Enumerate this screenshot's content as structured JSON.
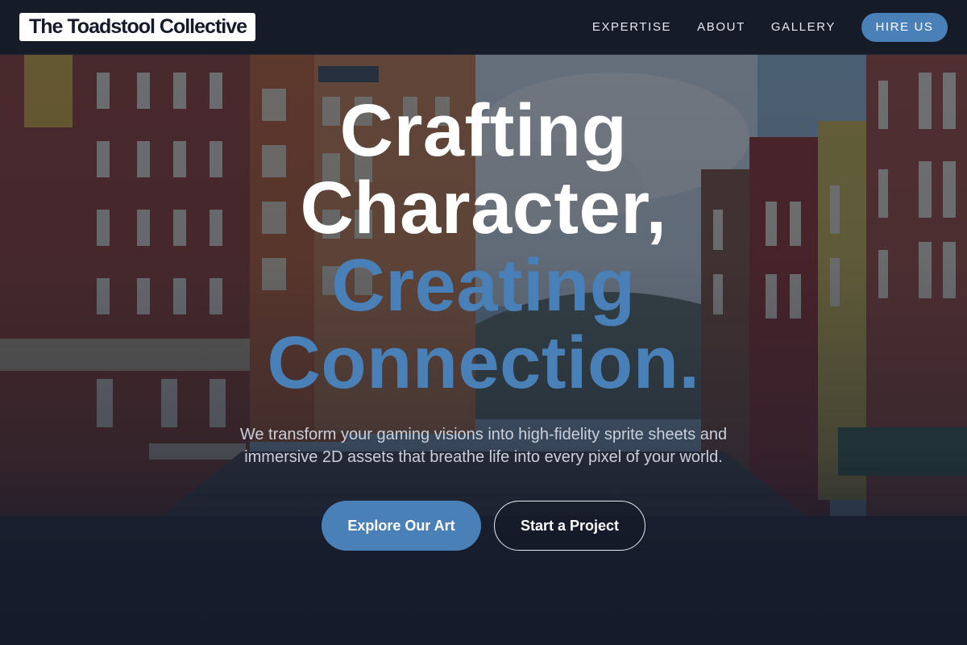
{
  "nav": {
    "brand": "The Toadstool Collective",
    "links": [
      {
        "label": "EXPERTISE"
      },
      {
        "label": "ABOUT"
      },
      {
        "label": "GALLERY"
      }
    ],
    "cta_label": "HIRE US"
  },
  "hero": {
    "headline_line1": "Crafting",
    "headline_line2": "Character,",
    "headline_line3": "Creating",
    "headline_line4": "Connection.",
    "subtitle": "We transform your gaming visions into high-fidelity sprite sheets and immersive 2D assets that breathe life into every pixel of your world.",
    "primary_button": "Explore Our Art",
    "secondary_button": "Start a Project"
  },
  "colors": {
    "accent": "#4a80b8",
    "navy": "#151b2b",
    "text_light": "#c9cfdb"
  }
}
